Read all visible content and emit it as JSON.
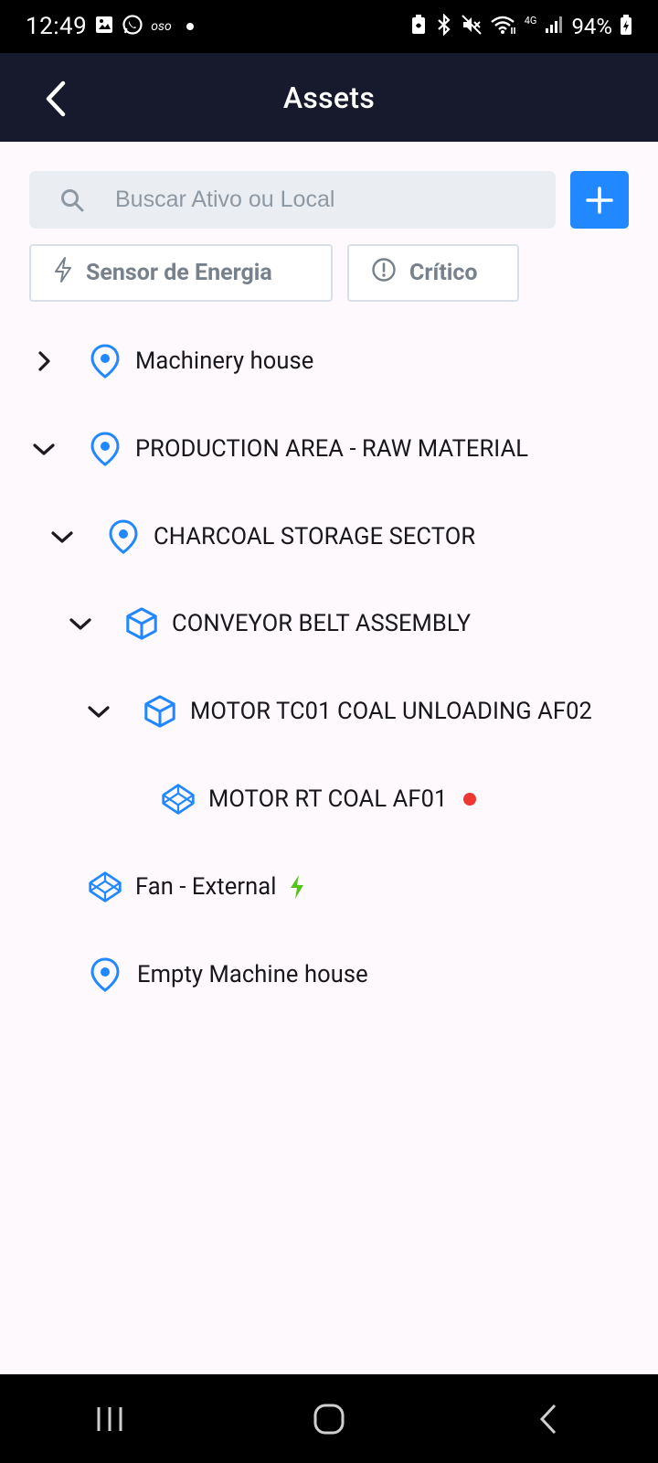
{
  "status_bar": {
    "time": "12:49",
    "carrier_tag": "oso",
    "network": "4G",
    "battery": "94%",
    "icons": [
      "gallery-icon",
      "whatsapp-icon",
      "dot-icon",
      "battery-saver-icon",
      "bluetooth-icon",
      "mute-icon",
      "wifi-icon",
      "signal-icon",
      "battery-icon"
    ]
  },
  "app_bar": {
    "title": "Assets",
    "back_icon": "back-arrow-icon"
  },
  "search": {
    "placeholder": "Buscar Ativo ou Local",
    "value": ""
  },
  "add_button": {
    "icon": "plus-icon"
  },
  "filters": [
    {
      "label": "Sensor de Energia",
      "icon": "bolt-icon"
    },
    {
      "label": "Crítico",
      "icon": "alert-circle-icon"
    }
  ],
  "tree": [
    {
      "label": "Machinery house",
      "type": "location",
      "expanded": false,
      "has_children": true,
      "depth": 0
    },
    {
      "label": "PRODUCTION AREA - RAW MATERIAL",
      "type": "location",
      "expanded": true,
      "has_children": true,
      "depth": 0
    },
    {
      "label": "CHARCOAL STORAGE SECTOR",
      "type": "location",
      "expanded": true,
      "has_children": true,
      "depth": 1
    },
    {
      "label": "CONVEYOR BELT ASSEMBLY",
      "type": "asset",
      "expanded": true,
      "has_children": true,
      "depth": 2
    },
    {
      "label": "MOTOR TC01 COAL UNLOADING AF02",
      "type": "asset",
      "expanded": true,
      "has_children": true,
      "depth": 3
    },
    {
      "label": "MOTOR RT COAL AF01",
      "type": "component",
      "status": "critical",
      "depth": 4
    },
    {
      "label": "Fan - External",
      "type": "component",
      "sensor": "energy",
      "depth": 0
    },
    {
      "label": "Empty Machine house",
      "type": "location",
      "depth": 0
    }
  ],
  "colors": {
    "app_bar": "#17192d",
    "accent": "#2188ff",
    "critical": "#ed3833",
    "energy": "#52c41a",
    "icon_blue": "#2188ff"
  },
  "nav_bar": {
    "icons": [
      "recents-icon",
      "home-icon",
      "back-icon"
    ]
  }
}
